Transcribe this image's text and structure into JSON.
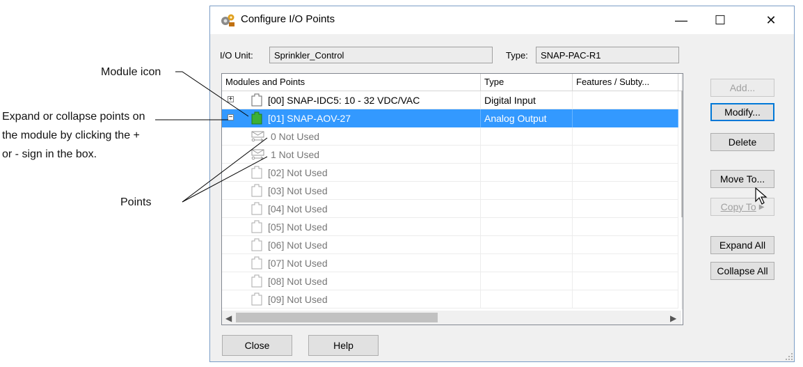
{
  "annotations": {
    "module_icon": "Module icon",
    "expand_line1": "Expand or collapse points on",
    "expand_line2": "the module by clicking the +",
    "expand_line3": "or - sign in the box.",
    "points": "Points"
  },
  "window": {
    "title": "Configure I/O Points",
    "minimize": "—",
    "maximize": "☐",
    "close": "✕"
  },
  "io_unit": {
    "label": "I/O Unit:",
    "value": "Sprinkler_Control"
  },
  "type": {
    "label": "Type:",
    "value": "SNAP-PAC-R1"
  },
  "grid": {
    "headers": [
      "Modules and Points",
      "Type",
      "Features / Subty..."
    ],
    "rows": [
      {
        "expander": "+",
        "label": "[00] SNAP-IDC5: 10 - 32 VDC/VAC",
        "type": "Digital Input",
        "kind": "module"
      },
      {
        "expander": "−",
        "label": "[01] SNAP-AOV-27",
        "type": "Analog Output",
        "kind": "module-active",
        "selected": true
      },
      {
        "label": "0  Not Used",
        "type": "",
        "kind": "point"
      },
      {
        "label": "1  Not Used",
        "type": "",
        "kind": "point"
      },
      {
        "label": "[02] Not Used",
        "type": "",
        "kind": "empty"
      },
      {
        "label": "[03] Not Used",
        "type": "",
        "kind": "empty"
      },
      {
        "label": "[04] Not Used",
        "type": "",
        "kind": "empty"
      },
      {
        "label": "[05] Not Used",
        "type": "",
        "kind": "empty"
      },
      {
        "label": "[06] Not Used",
        "type": "",
        "kind": "empty"
      },
      {
        "label": "[07] Not Used",
        "type": "",
        "kind": "empty"
      },
      {
        "label": "[08] Not Used",
        "type": "",
        "kind": "empty"
      },
      {
        "label": "[09] Not Used",
        "type": "",
        "kind": "empty"
      }
    ]
  },
  "buttons": {
    "add": "Add...",
    "modify": "Modify...",
    "delete": "Delete",
    "move_to": "Move To...",
    "copy_to": "Copy To",
    "expand_all": "Expand All",
    "collapse_all": "Collapse All",
    "close": "Close",
    "help": "Help"
  },
  "colors": {
    "selection": "#3399ff",
    "module_active": "#3cb034"
  },
  "icons": [
    "title-gear-icon",
    "module-icon",
    "point-icon",
    "cursor-icon",
    "scroll-up-icon",
    "scroll-down-icon",
    "scroll-left-icon",
    "scroll-right-icon",
    "resize-grip-icon"
  ]
}
